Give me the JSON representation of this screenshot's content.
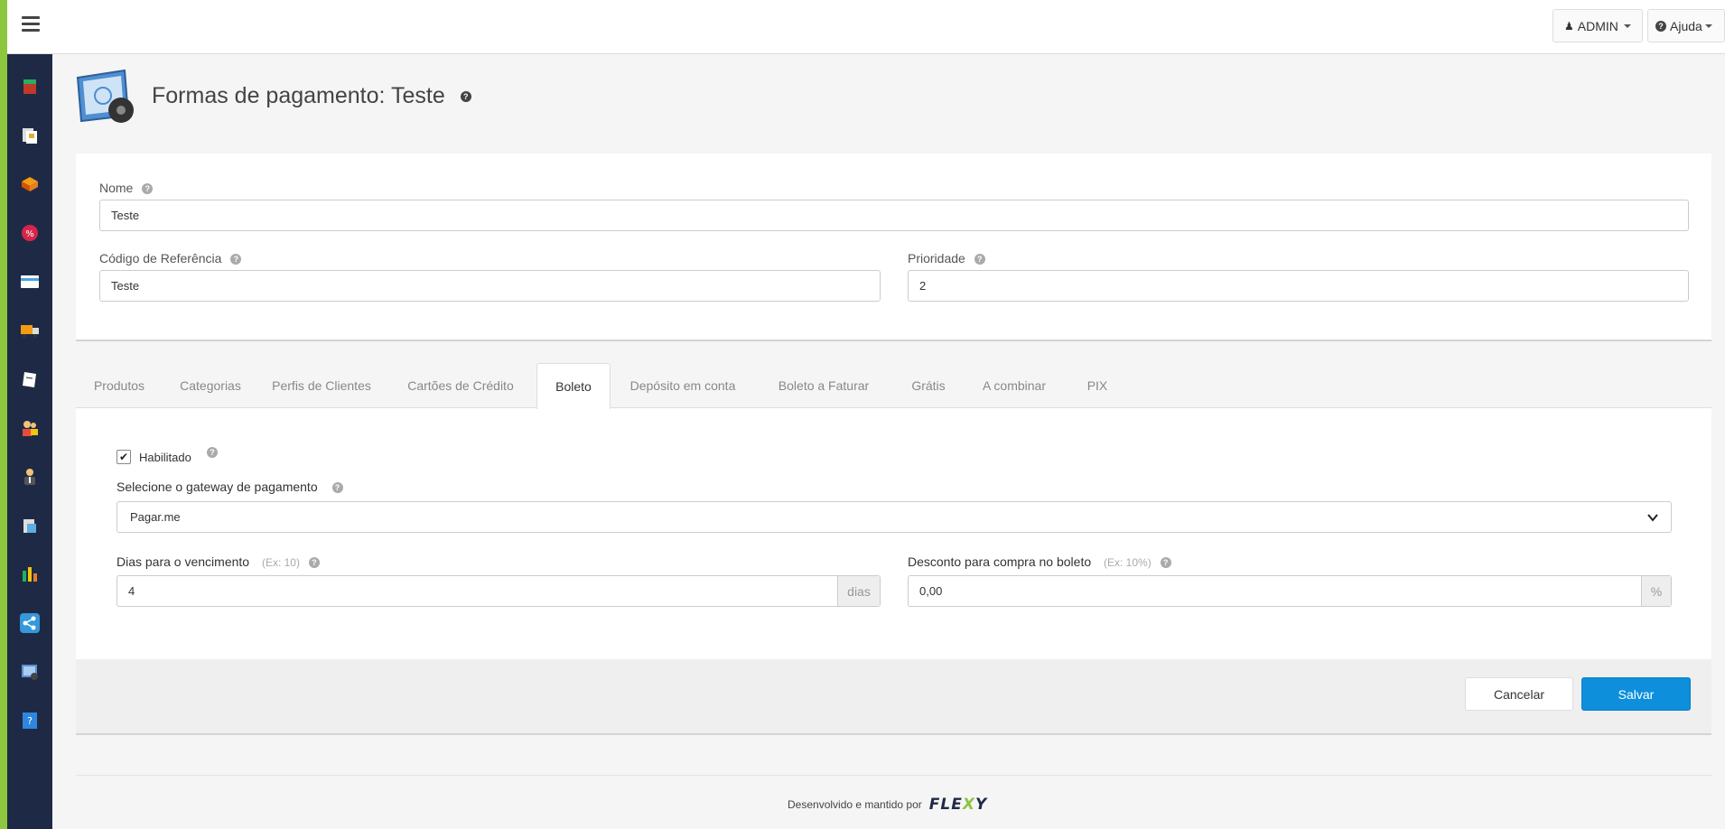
{
  "topbar": {
    "admin_label": "ADMIN",
    "help_label": "Ajuda"
  },
  "sidebar": {
    "items": [
      {
        "icon": "box-icon",
        "color": "#c0392b"
      },
      {
        "icon": "documents-icon",
        "color": "#e0b030"
      },
      {
        "icon": "package-icon",
        "color": "#e67e22"
      },
      {
        "icon": "discount-icon",
        "color": "#d6254b"
      },
      {
        "icon": "card-icon",
        "color": "#4aa3df"
      },
      {
        "icon": "truck-icon",
        "color": "#f39c12"
      },
      {
        "icon": "note-icon",
        "color": "#ffffff"
      },
      {
        "icon": "users-icon",
        "color": "#e74c3c"
      },
      {
        "icon": "person-icon",
        "color": "#f0c27b"
      },
      {
        "icon": "database-icon",
        "color": "#5dade2"
      },
      {
        "icon": "chart-icon",
        "color": "#27ae60"
      },
      {
        "icon": "share-icon",
        "color": "#3498db"
      },
      {
        "icon": "settings-screen-icon",
        "color": "#5b8fd1"
      },
      {
        "icon": "help-book-icon",
        "color": "#2e86de"
      }
    ]
  },
  "header": {
    "title": "Formas de pagamento: Teste"
  },
  "form": {
    "nome_label": "Nome",
    "nome_value": "Teste",
    "codigo_label": "Código de Referência",
    "codigo_value": "Teste",
    "prioridade_label": "Prioridade",
    "prioridade_value": "2"
  },
  "tabs": [
    {
      "label": "Produtos"
    },
    {
      "label": "Categorias"
    },
    {
      "label": "Perfis de Clientes"
    },
    {
      "label": "Cartões de Crédito"
    },
    {
      "label": "Boleto",
      "active": true
    },
    {
      "label": "Depósito em conta"
    },
    {
      "label": "Boleto a Faturar"
    },
    {
      "label": "Grátis"
    },
    {
      "label": "A combinar"
    },
    {
      "label": "PIX"
    }
  ],
  "boleto": {
    "habilitado_label": "Habilitado",
    "habilitado_checked": true,
    "gateway_label": "Selecione o gateway de pagamento",
    "gateway_value": "Pagar.me",
    "dias_label": "Dias para o vencimento",
    "dias_hint": "(Ex: 10)",
    "dias_value": "4",
    "dias_addon": "dias",
    "desconto_label": "Desconto para compra no boleto",
    "desconto_hint": "(Ex: 10%)",
    "desconto_value": "0,00",
    "desconto_addon": "%"
  },
  "actions": {
    "cancel_label": "Cancelar",
    "save_label": "Salvar"
  },
  "footer": {
    "credit_text": "Desenvolvido e mantido por",
    "brand": "FLEXY"
  },
  "colors": {
    "accent_green": "#8dc63f",
    "sidebar_bg": "#1e2a45",
    "primary_blue": "#0d8fdc"
  }
}
